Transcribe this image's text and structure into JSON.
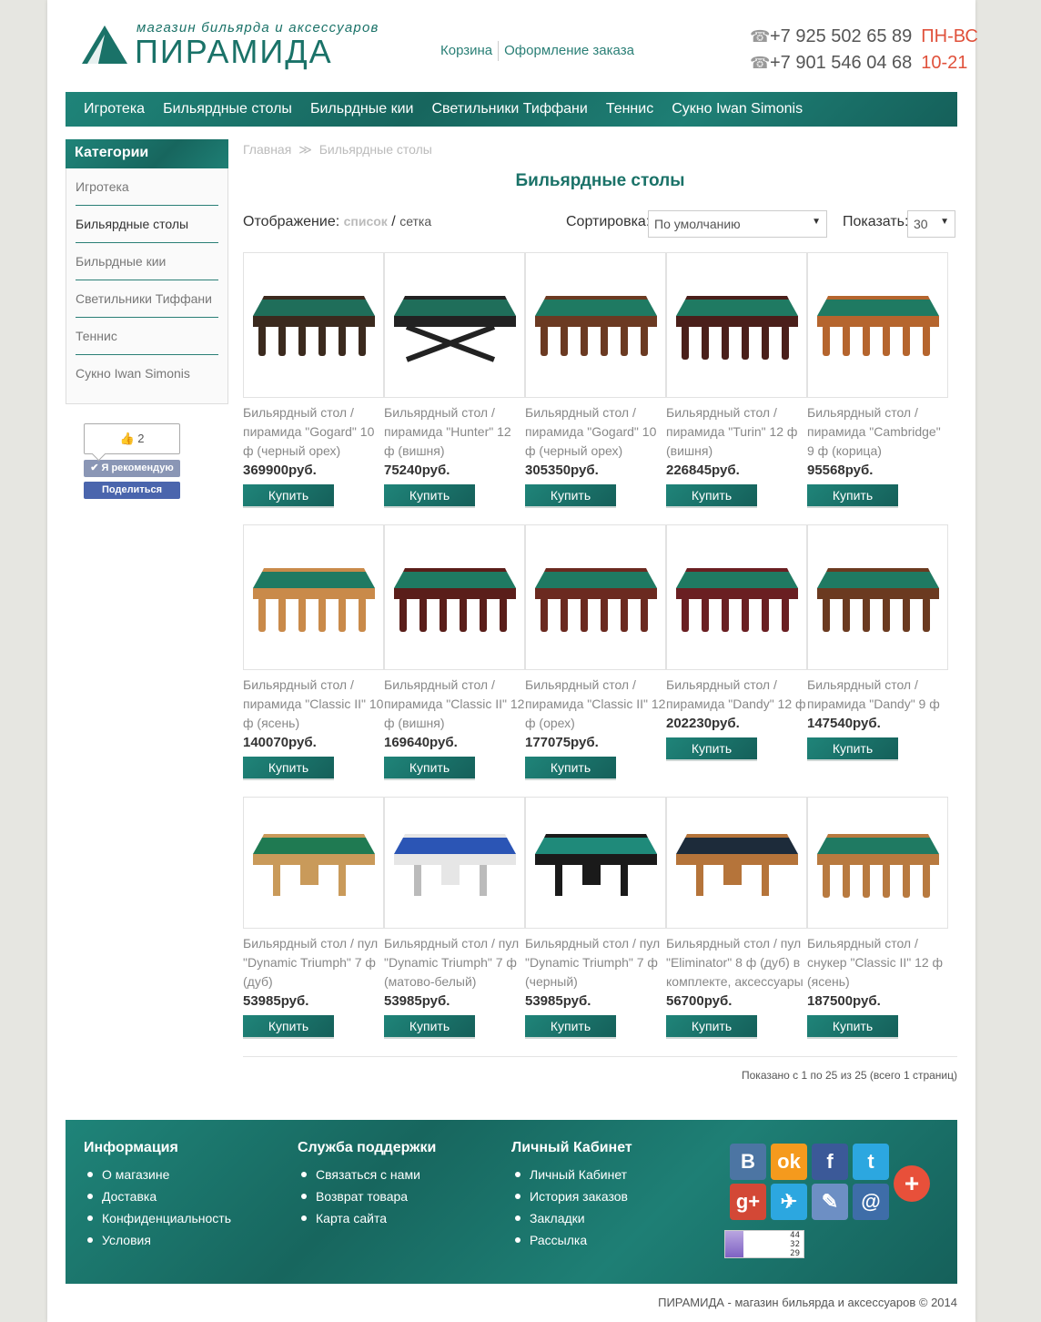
{
  "header": {
    "tagline": "магазин бильярда и аксессуаров",
    "logo_name": "ПИРАМИДА",
    "links": [
      "Корзина",
      "Оформление заказа"
    ],
    "phones": [
      {
        "number": "+7 925 502 65 89",
        "hours": "ПН-ВС"
      },
      {
        "number": "+7 901 546 04 68",
        "hours": "10-21"
      }
    ]
  },
  "nav": [
    "Игротека",
    "Бильярдные столы",
    "Бильрдные кии",
    "Светильники Тиффани",
    "Теннис",
    "Сукно Iwan Simonis"
  ],
  "sidebar": {
    "title": "Категории",
    "items": [
      "Игротека",
      "Бильярдные столы",
      "Бильрдные кии",
      "Светильники Тиффани",
      "Теннис",
      "Сукно Iwan Simonis"
    ],
    "active_index": 1
  },
  "social_widget": {
    "like_count": "2",
    "recommend_label": "Я рекомендую",
    "share_label": "Поделиться"
  },
  "breadcrumb": [
    "Главная",
    "Бильярдные столы"
  ],
  "page_title": "Бильярдные столы",
  "controls": {
    "display_label": "Отображение:",
    "display_list": "список",
    "display_sep": "/",
    "display_grid": "сетка",
    "sort_label": "Сортировка:",
    "sort_value": "По умолчанию",
    "show_label": "Показать:",
    "show_value": "30"
  },
  "buy_label": "Купить",
  "products": [
    {
      "name": "Бильярдный стол / пирамида \"Gogard\" 10 ф (черный орех)",
      "price": "369900руб.",
      "felt": "#1f6e5a",
      "wood": "#3b2a1e",
      "style": "carved"
    },
    {
      "name": "Бильярдный стол / пирамида \"Hunter\" 12 ф (вишня)",
      "price": "75240руб.",
      "felt": "#1f6e5a",
      "wood": "#222222",
      "style": "cross"
    },
    {
      "name": "Бильярдный стол / пирамида \"Gogard\" 10 ф (черный орех)",
      "price": "305350руб.",
      "felt": "#1f7a62",
      "wood": "#6b3a22",
      "style": "carved"
    },
    {
      "name": "Бильярдный стол / пирамида \"Turin\" 12 ф (вишня)",
      "price": "226845руб.",
      "felt": "#1f7a62",
      "wood": "#4a1f1a",
      "style": "legs"
    },
    {
      "name": "Бильярдный стол / пирамида \"Cambridge\" 9 ф (корица)",
      "price": "95568руб.",
      "felt": "#1f7a62",
      "wood": "#b5652e",
      "style": "carved"
    },
    {
      "name": "Бильярдный стол / пирамида \"Classic II\" 10 ф (ясень)",
      "price": "140070руб.",
      "felt": "#1f7a62",
      "wood": "#c98a4a",
      "style": "legs"
    },
    {
      "name": "Бильярдный стол / пирамида \"Classic II\" 12 ф (вишня)",
      "price": "169640руб.",
      "felt": "#1f7a62",
      "wood": "#5a1e1a",
      "style": "legs"
    },
    {
      "name": "Бильярдный стол / пирамида \"Classic II\" 12 ф (орех)",
      "price": "177075руб.",
      "felt": "#1f7a62",
      "wood": "#6b2a20",
      "style": "legs"
    },
    {
      "name": "Бильярдный стол / пирамида \"Dandy\" 12 ф",
      "price": "202230руб.",
      "felt": "#1f7a62",
      "wood": "#6a1f22",
      "style": "legs"
    },
    {
      "name": "Бильярдный стол / пирамида \"Dandy\" 9 ф",
      "price": "147540руб.",
      "felt": "#1f7a62",
      "wood": "#6b3a20",
      "style": "legs"
    },
    {
      "name": "Бильярдный стол / пул \"Dynamic Triumph\" 7 ф (дуб)",
      "price": "53985руб.",
      "felt": "#1f7a52",
      "wood": "#c99a5a",
      "style": "pool"
    },
    {
      "name": "Бильярдный стол / пул \"Dynamic Triumph\" 7 ф (матово-белый)",
      "price": "53985руб.",
      "felt": "#2b55b5",
      "wood": "#e6e6e6",
      "style": "pool"
    },
    {
      "name": "Бильярдный стол / пул \"Dynamic Triumph\" 7 ф (черный)",
      "price": "53985руб.",
      "felt": "#1f8a7a",
      "wood": "#1a1a1a",
      "style": "pool"
    },
    {
      "name": "Бильярдный стол / пул \"Eliminator\" 8 ф (дуб) в комплекте, аксессуары",
      "price": "56700руб.",
      "felt": "#1d2b3a",
      "wood": "#b5743a",
      "style": "pool"
    },
    {
      "name": "Бильярдный стол / снукер \"Classic II\" 12 ф (ясень)",
      "price": "187500руб.",
      "felt": "#1f7a62",
      "wood": "#b87a40",
      "style": "legs"
    }
  ],
  "pagination_text": "Показано с 1 по 25 из 25 (всего 1 страниц)",
  "footer": {
    "columns": [
      {
        "title": "Информация",
        "links": [
          "О магазине",
          "Доставка",
          "Конфиденциальность",
          "Условия"
        ]
      },
      {
        "title": "Служба поддержки",
        "links": [
          "Связаться с нами",
          "Возврат товара",
          "Карта сайта"
        ]
      },
      {
        "title": "Личный Кабинет",
        "links": [
          "Личный Кабинет",
          "История заказов",
          "Закладки",
          "Рассылка"
        ]
      }
    ],
    "social": [
      {
        "icon": "vk-icon",
        "glyph": "В",
        "color": "#4c75a3"
      },
      {
        "icon": "odnoklassniki-icon",
        "glyph": "ok",
        "color": "#f59a1d"
      },
      {
        "icon": "facebook-icon",
        "glyph": "f",
        "color": "#3b5998"
      },
      {
        "icon": "twitter-icon",
        "glyph": "t",
        "color": "#2ca7e0"
      },
      {
        "icon": "google-plus-icon",
        "glyph": "g+",
        "color": "#d34836"
      },
      {
        "icon": "livejournal-icon",
        "glyph": "✈",
        "color": "#2ca7e0"
      },
      {
        "icon": "blog-icon",
        "glyph": "✎",
        "color": "#6d8fc4"
      },
      {
        "icon": "mail-icon",
        "glyph": "@",
        "color": "#3e6da8"
      }
    ],
    "more_icon": "+",
    "counter": [
      "44",
      "32",
      "29"
    ]
  },
  "copyright": "ПИРАМИДА - магазин бильярда и аксессуаров © 2014",
  "colors": {
    "accent": "#1a7268",
    "hours": "#e0513b"
  }
}
